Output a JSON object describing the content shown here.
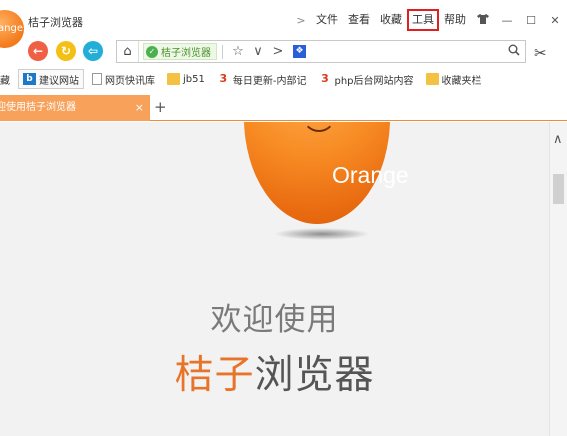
{
  "window": {
    "title": "桔子浏览器",
    "logo_text": "Orange"
  },
  "menu": {
    "items": [
      "文件",
      "查看",
      "收藏",
      "工具",
      "帮助"
    ],
    "highlighted": "工具",
    "chevron": ">",
    "shirt_icon": "tshirt-icon",
    "minimize": "—",
    "maximize": "☐",
    "close": "✕"
  },
  "navbar": {
    "back": "←",
    "refresh": "↻",
    "stop": "⇦",
    "home": "⌂",
    "site_badge": "桔子浏览器",
    "star": "☆",
    "dropdown": "∨",
    "forward_arrow": ">",
    "search": "⌕",
    "scissors": "✂"
  },
  "bookmarks": [
    {
      "label": "藏",
      "icon": "none"
    },
    {
      "label": "建议网站",
      "icon": "b-icon"
    },
    {
      "label": "网页快讯库",
      "icon": "page-icon"
    },
    {
      "label": "jb51",
      "icon": "folder-icon"
    },
    {
      "label": "每日更新-内部记",
      "icon": "3-icon"
    },
    {
      "label": "php后台网站内容",
      "icon": "3-icon"
    },
    {
      "label": "收藏夹栏",
      "icon": "folder-icon"
    }
  ],
  "tabs": {
    "active_label": "迎使用桔子浏览器",
    "close": "×",
    "new_tab": "+"
  },
  "content": {
    "orange_label": "Orange",
    "welcome": "欢迎使用",
    "brand_accent": "桔子",
    "brand_rest": "浏览器"
  },
  "scrollbar": {
    "up": "∧"
  },
  "colors": {
    "accent": "#f7a15a",
    "orange": "#f78a22",
    "highlight_box": "#e02020"
  }
}
